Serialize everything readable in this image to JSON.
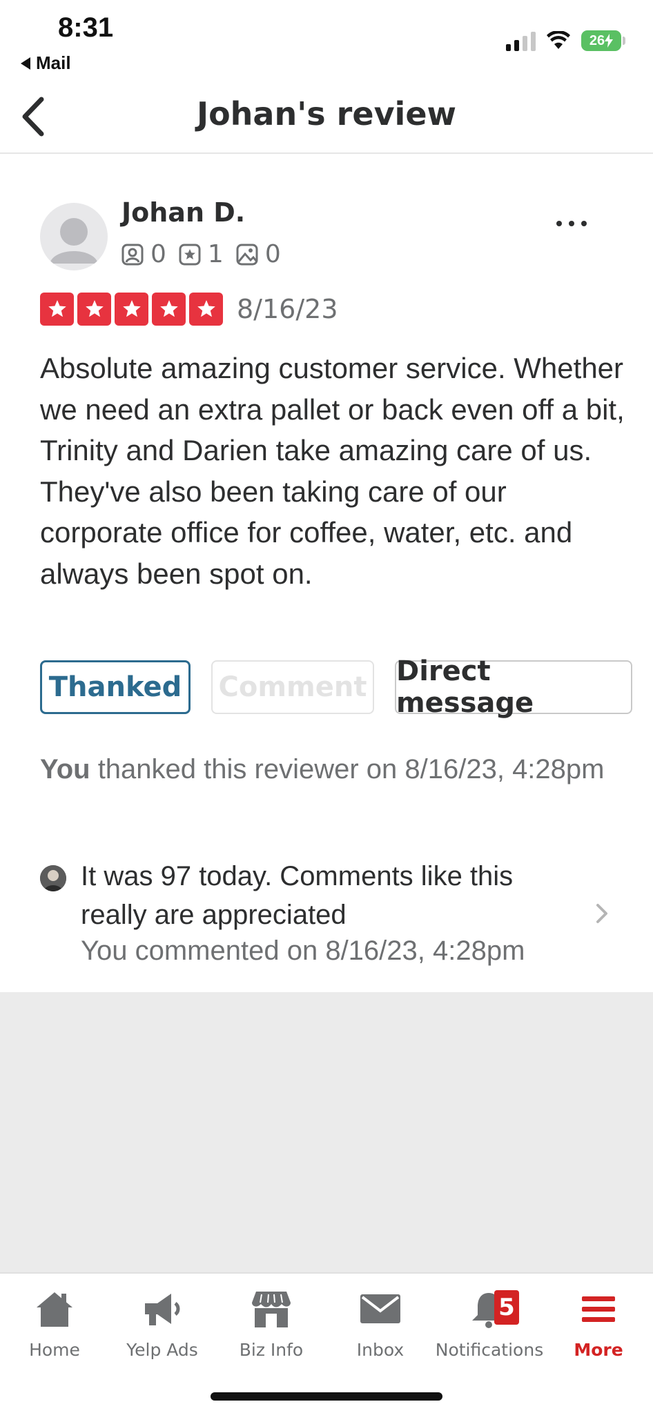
{
  "status_bar": {
    "time": "8:31",
    "back_app": "Mail",
    "battery": "26"
  },
  "nav": {
    "title": "Johan's review",
    "back_icon": "chevron-left-icon"
  },
  "review": {
    "reviewer_name": "Johan D.",
    "friends_count": "0",
    "reviews_count": "1",
    "photos_count": "0",
    "rating": 5,
    "rating_max": 5,
    "date": "8/16/23",
    "text": "Absolute amazing customer service. Whether we need an extra pallet or back even off a bit, Trinity and Darien take amazing care of us. They've also been taking care of our corporate office for coffee, water, etc. and always been spot on.",
    "star_color": "#e7333f"
  },
  "actions": {
    "thanked_label": "Thanked",
    "comment_label": "Comment",
    "direct_message_label": "Direct message"
  },
  "thanked_note": {
    "subject": "You",
    "rest": " thanked this reviewer on 8/16/23, 4:28pm"
  },
  "owner_comment": {
    "text": "It was 97 today.  Comments like this really are appreciated",
    "meta": "You commented on 8/16/23, 4:28pm"
  },
  "tab_bar": {
    "accent_color": "#d32323",
    "tabs": [
      {
        "label": "Home",
        "icon": "home-icon"
      },
      {
        "label": "Yelp Ads",
        "icon": "megaphone-icon"
      },
      {
        "label": "Biz Info",
        "icon": "storefront-icon"
      },
      {
        "label": "Inbox",
        "icon": "envelope-icon"
      },
      {
        "label": "Notifications",
        "icon": "bell-icon",
        "badge": "5"
      },
      {
        "label": "More",
        "icon": "hamburger-menu-icon",
        "active": true
      }
    ]
  }
}
